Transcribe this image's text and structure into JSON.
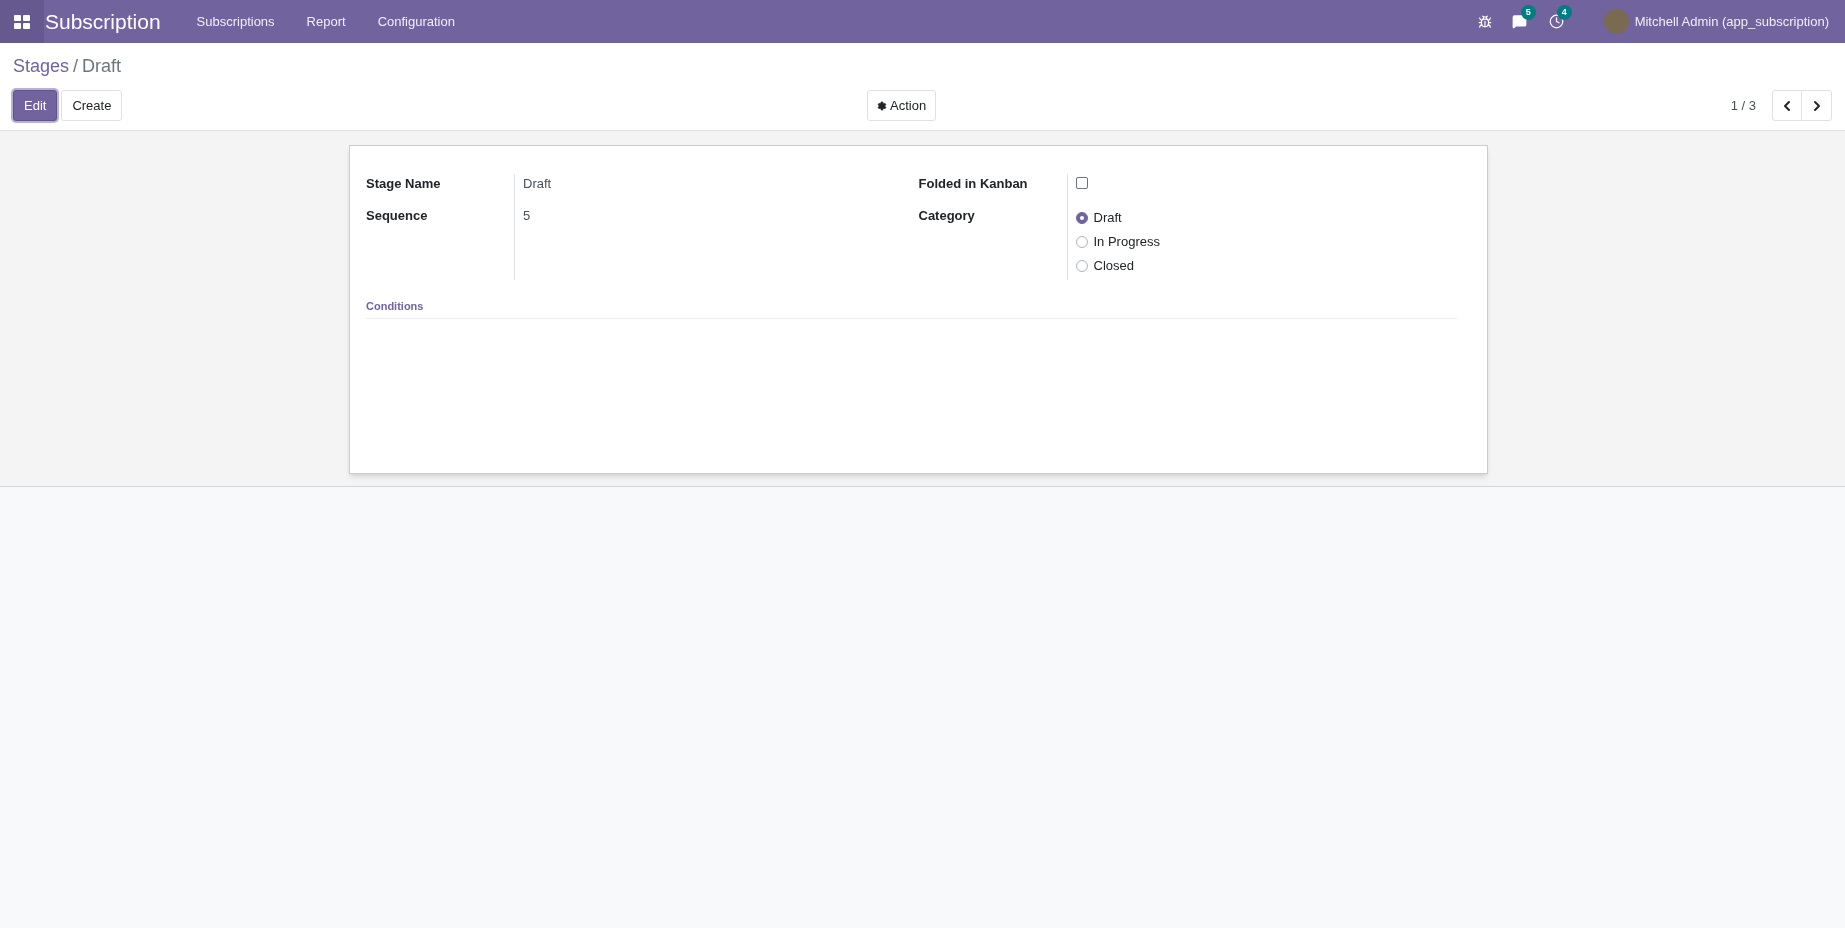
{
  "navbar": {
    "app_name": "Subscription",
    "menu": [
      "Subscriptions",
      "Report",
      "Configuration"
    ],
    "messages_count": "5",
    "activities_count": "4",
    "user": "Mitchell Admin (app_subscription)"
  },
  "breadcrumb": [
    "Stages",
    "/",
    "Draft"
  ],
  "buttons": {
    "edit": "Edit",
    "create": "Create",
    "action": "Action"
  },
  "pager": "1 / 3",
  "form": {
    "left": [
      {
        "label": "Stage Name",
        "value": "Draft"
      },
      {
        "label": "Sequence",
        "value": "5"
      }
    ],
    "folded": {
      "label": "Folded in Kanban",
      "checked": false
    },
    "category": {
      "label": "Category",
      "options": [
        {
          "label": "Draft",
          "selected": true
        },
        {
          "label": "In Progress",
          "selected": false
        },
        {
          "label": "Closed",
          "selected": false
        }
      ]
    },
    "section": "Conditions"
  }
}
